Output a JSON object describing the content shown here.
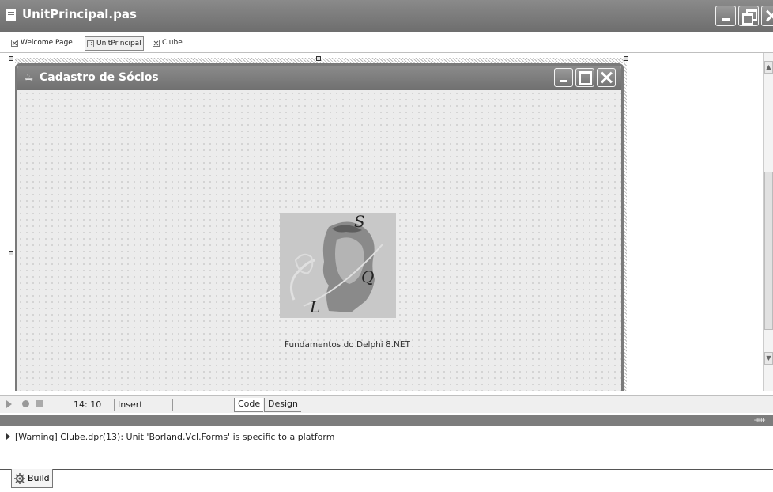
{
  "window": {
    "title": "UnitPrincipal.pas"
  },
  "tabs": [
    {
      "label": "Welcome Page"
    },
    {
      "label": "UnitPrincipal"
    },
    {
      "label": "Clube"
    }
  ],
  "form": {
    "title": "Cadastro de Sócios",
    "caption": "Fundamentos do Delphi 8.NET",
    "logo_letters": [
      "S",
      "Q",
      "L"
    ]
  },
  "statusbar": {
    "position": "14: 10",
    "mode": "Insert",
    "tab_code": "Code",
    "tab_design": "Design"
  },
  "messages": [
    {
      "text": "[Warning] Clube.dpr(13): Unit 'Borland.Vcl.Forms' is specific to a platform"
    }
  ],
  "bottom_tab": {
    "label": "Build"
  }
}
